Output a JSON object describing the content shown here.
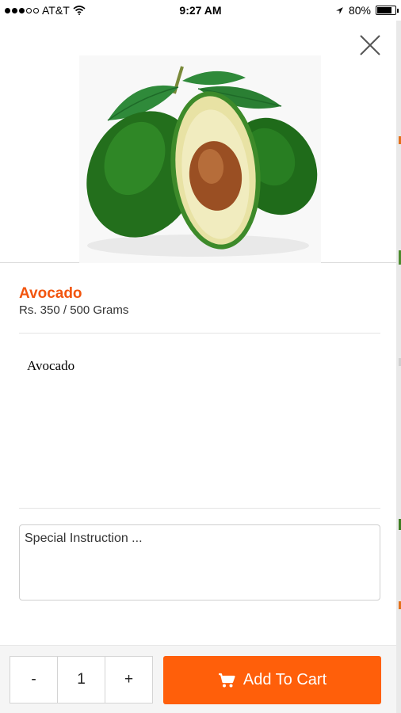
{
  "status_bar": {
    "carrier": "AT&T",
    "time": "9:27 AM",
    "battery": "80%",
    "battery_level": 0.8
  },
  "product": {
    "name": "Avocado",
    "price": "Rs. 350 / 500 Grams",
    "description": "Avocado",
    "image_icon": "avocado-photo"
  },
  "instructions": {
    "placeholder": "Special Instruction ..."
  },
  "quantity": {
    "minus_label": "-",
    "value": "1",
    "plus_label": "+"
  },
  "cart": {
    "label": "Add To Cart",
    "icon": "shopping-cart-icon"
  },
  "colors": {
    "accent": "#ff5f0a",
    "title": "#f2550e"
  }
}
